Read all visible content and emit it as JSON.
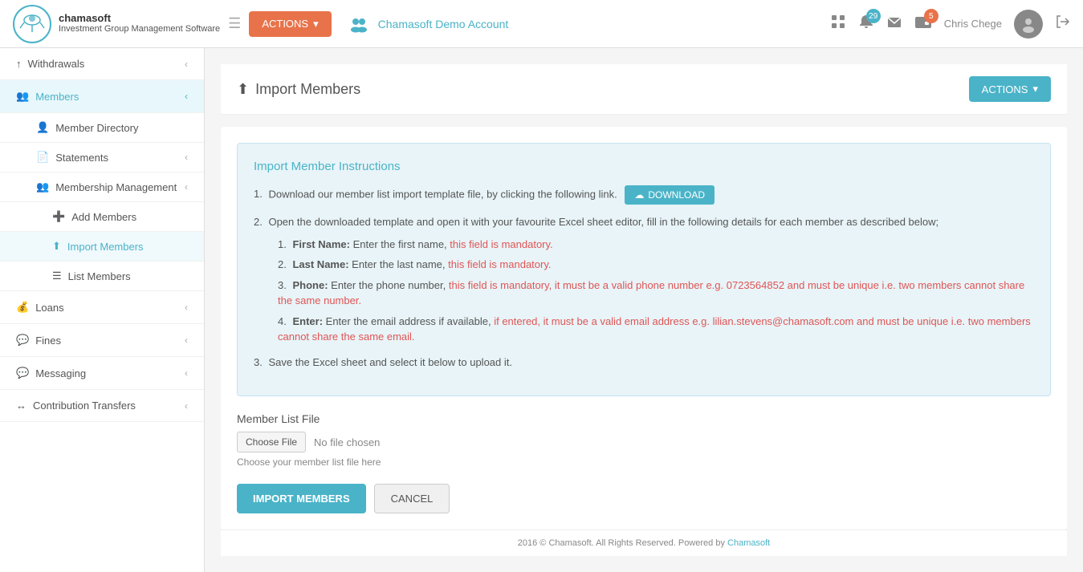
{
  "app": {
    "name": "chamasoft",
    "tagline": "Investment Group Management Software",
    "account_name": "Chamasoft Demo Account"
  },
  "topbar": {
    "actions_label": "ACTIONS",
    "notifications_count": "29",
    "messages_count": "5",
    "user_name": "Chris Chege"
  },
  "sidebar": {
    "items": [
      {
        "id": "withdrawals",
        "label": "Withdrawals",
        "icon": "↑",
        "has_sub": true
      },
      {
        "id": "members",
        "label": "Members",
        "icon": "👥",
        "has_sub": true,
        "expanded": true
      },
      {
        "id": "member-directory",
        "label": "Member Directory",
        "icon": "👤",
        "sub": true
      },
      {
        "id": "statements",
        "label": "Statements",
        "icon": "📄",
        "sub": true,
        "has_sub": true
      },
      {
        "id": "membership-management",
        "label": "Membership Management",
        "icon": "👥",
        "sub": true,
        "has_sub": true,
        "expanded": true
      },
      {
        "id": "add-members",
        "label": "Add Members",
        "icon": "➕",
        "sub2": true
      },
      {
        "id": "import-members",
        "label": "Import Members",
        "icon": "⬆",
        "sub2": true,
        "active": true
      },
      {
        "id": "list-members",
        "label": "List Members",
        "icon": "☰",
        "sub2": true
      },
      {
        "id": "loans",
        "label": "Loans",
        "icon": "💰",
        "has_sub": true
      },
      {
        "id": "fines",
        "label": "Fines",
        "icon": "💬",
        "has_sub": true
      },
      {
        "id": "messaging",
        "label": "Messaging",
        "icon": "💬",
        "has_sub": true
      },
      {
        "id": "contribution-transfers",
        "label": "Contribution Transfers",
        "icon": "↔",
        "has_sub": true
      }
    ]
  },
  "page": {
    "title": "Import Members",
    "actions_label": "ACTIONS"
  },
  "instructions": {
    "title": "Import Member Instructions",
    "steps": [
      {
        "num": "1.",
        "text_before": "Download our member list import template file, by clicking the following link.",
        "download_label": "DOWNLOAD"
      },
      {
        "num": "2.",
        "text": "Open the downloaded template and open it with your favourite Excel sheet editor, fill in the following details for each member as described below;",
        "sub_steps": [
          {
            "num": "1.",
            "label": "First Name:",
            "text_normal": "Enter the first name,",
            "text_red": "this field is mandatory."
          },
          {
            "num": "2.",
            "label": "Last Name:",
            "text_normal": "Enter the last name,",
            "text_red": "this field is mandatory."
          },
          {
            "num": "3.",
            "label": "Phone:",
            "text_normal": "Enter the phone number,",
            "text_red": "this field is mandatory, it must be a valid phone number e.g. 0723564852 and must be unique i.e. two members cannot share the same number."
          },
          {
            "num": "4.",
            "label": "Enter:",
            "text_normal": "Enter the email address if available,",
            "text_red": "if entered, it must be a valid email address e.g. lilian.stevens@chamasoft.com and must be unique i.e. two members cannot share the same email."
          }
        ]
      },
      {
        "num": "3.",
        "text": "Save the Excel sheet and select it below to upload it."
      }
    ]
  },
  "file_section": {
    "label": "Member List File",
    "choose_label": "Choose File",
    "no_file_text": "No file chosen",
    "hint": "Choose your member list file here"
  },
  "form_actions": {
    "import_label": "IMPORT MEMBERS",
    "cancel_label": "CANCEL"
  },
  "footer": {
    "text": "2016 © Chamasoft. All Rights Reserved. Powered by",
    "link_text": "Chamasoft"
  }
}
